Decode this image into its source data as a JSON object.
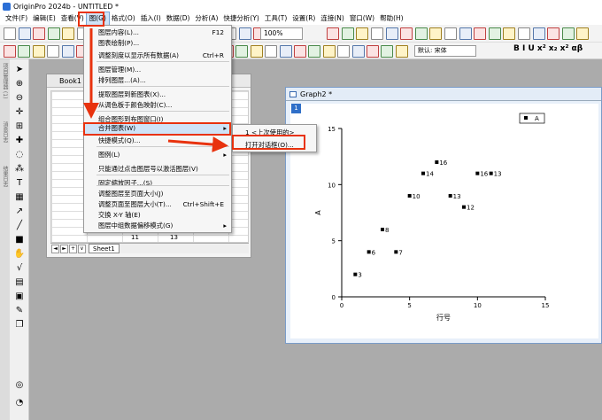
{
  "window": {
    "title": "OriginPro 2024b - UNTITLED *"
  },
  "menubar": {
    "items": [
      "文件(F)",
      "编辑(E)",
      "查看(V)",
      "图(G)",
      "格式(O)",
      "插入(I)",
      "数据(D)",
      "分析(A)",
      "快捷分析(Y)",
      "工具(T)",
      "设置(R)",
      "连接(N)",
      "窗口(W)",
      "帮助(H)"
    ],
    "active_index": 3
  },
  "toolbar": {
    "zoom_value": "100%",
    "font_value": "默认: 宋体",
    "format_text": "B I U x² x₂ x² αβ"
  },
  "side_labels": [
    "项目管理器 (1)",
    "消息日志",
    "结果日志"
  ],
  "book1": {
    "title": "Book1",
    "sheet_tab": "Sheet1",
    "row_nums": [
      "11",
      "13"
    ]
  },
  "graph_menu": {
    "items": [
      {
        "label": "图层内容(L)...",
        "shortcut": "F12"
      },
      {
        "label": "图表绘制(P)..."
      },
      {
        "label": "调整刻度以显示所有数据(A)",
        "shortcut": "Ctrl+R"
      },
      {
        "label": "图层管理(M)..."
      },
      {
        "label": "排列图层...(A)..."
      },
      {
        "label": "提取图层到新图表(X)..."
      },
      {
        "label": "从调色板于颜色映射(C)..."
      },
      {
        "label": "组合图形到布图窗口(I)"
      },
      {
        "label": "合并图表(W)",
        "submenu": true,
        "highlight": true
      },
      {
        "label": "快捷模式(Q)..."
      },
      {
        "label": "图例(L)",
        "submenu": true
      },
      {
        "label": "只能通过点击图层号以激活图层(V)"
      },
      {
        "label": "固定缩放因子...(S)"
      },
      {
        "label": "调整图层至页面大小(J)"
      },
      {
        "label": "调整页面至图层大小(T)...",
        "shortcut": "Ctrl+Shift+E"
      },
      {
        "label": "交换 X-Y 轴(E)"
      },
      {
        "label": "图层中组数据偏移模式(G)",
        "submenu": true
      }
    ]
  },
  "merge_submenu": {
    "items": [
      "1 <上次使用的>",
      "打开对话框(O)..."
    ]
  },
  "graph2": {
    "title": "Graph2 *",
    "layer": "1",
    "legend_label": "A"
  },
  "chart_data": {
    "type": "scatter",
    "xlabel": "行号",
    "ylabel": "A",
    "xlim": [
      0,
      15
    ],
    "ylim": [
      0,
      15
    ],
    "xticks": [
      0,
      5,
      10,
      15
    ],
    "yticks": [
      0,
      5,
      10,
      15
    ],
    "points": [
      {
        "x": 1,
        "y": 2,
        "label": "3"
      },
      {
        "x": 2,
        "y": 4,
        "label": "6"
      },
      {
        "x": 3,
        "y": 6,
        "label": "8"
      },
      {
        "x": 4,
        "y": 4,
        "label": "7"
      },
      {
        "x": 5,
        "y": 9,
        "label": "10"
      },
      {
        "x": 6,
        "y": 11,
        "label": "14"
      },
      {
        "x": 7,
        "y": 12,
        "label": "16"
      },
      {
        "x": 8,
        "y": 9,
        "label": "13"
      },
      {
        "x": 9,
        "y": 8,
        "label": "12"
      },
      {
        "x": 10,
        "y": 11,
        "label": "16"
      },
      {
        "x": 11,
        "y": 11,
        "label": "13"
      }
    ],
    "legend": [
      "A"
    ],
    "grid": false,
    "legend_position": "top-right"
  },
  "colors": {
    "highlight": "#e8320e",
    "menu_hover": "#cfe3f7",
    "layer_badge": "#2f6fc8"
  }
}
